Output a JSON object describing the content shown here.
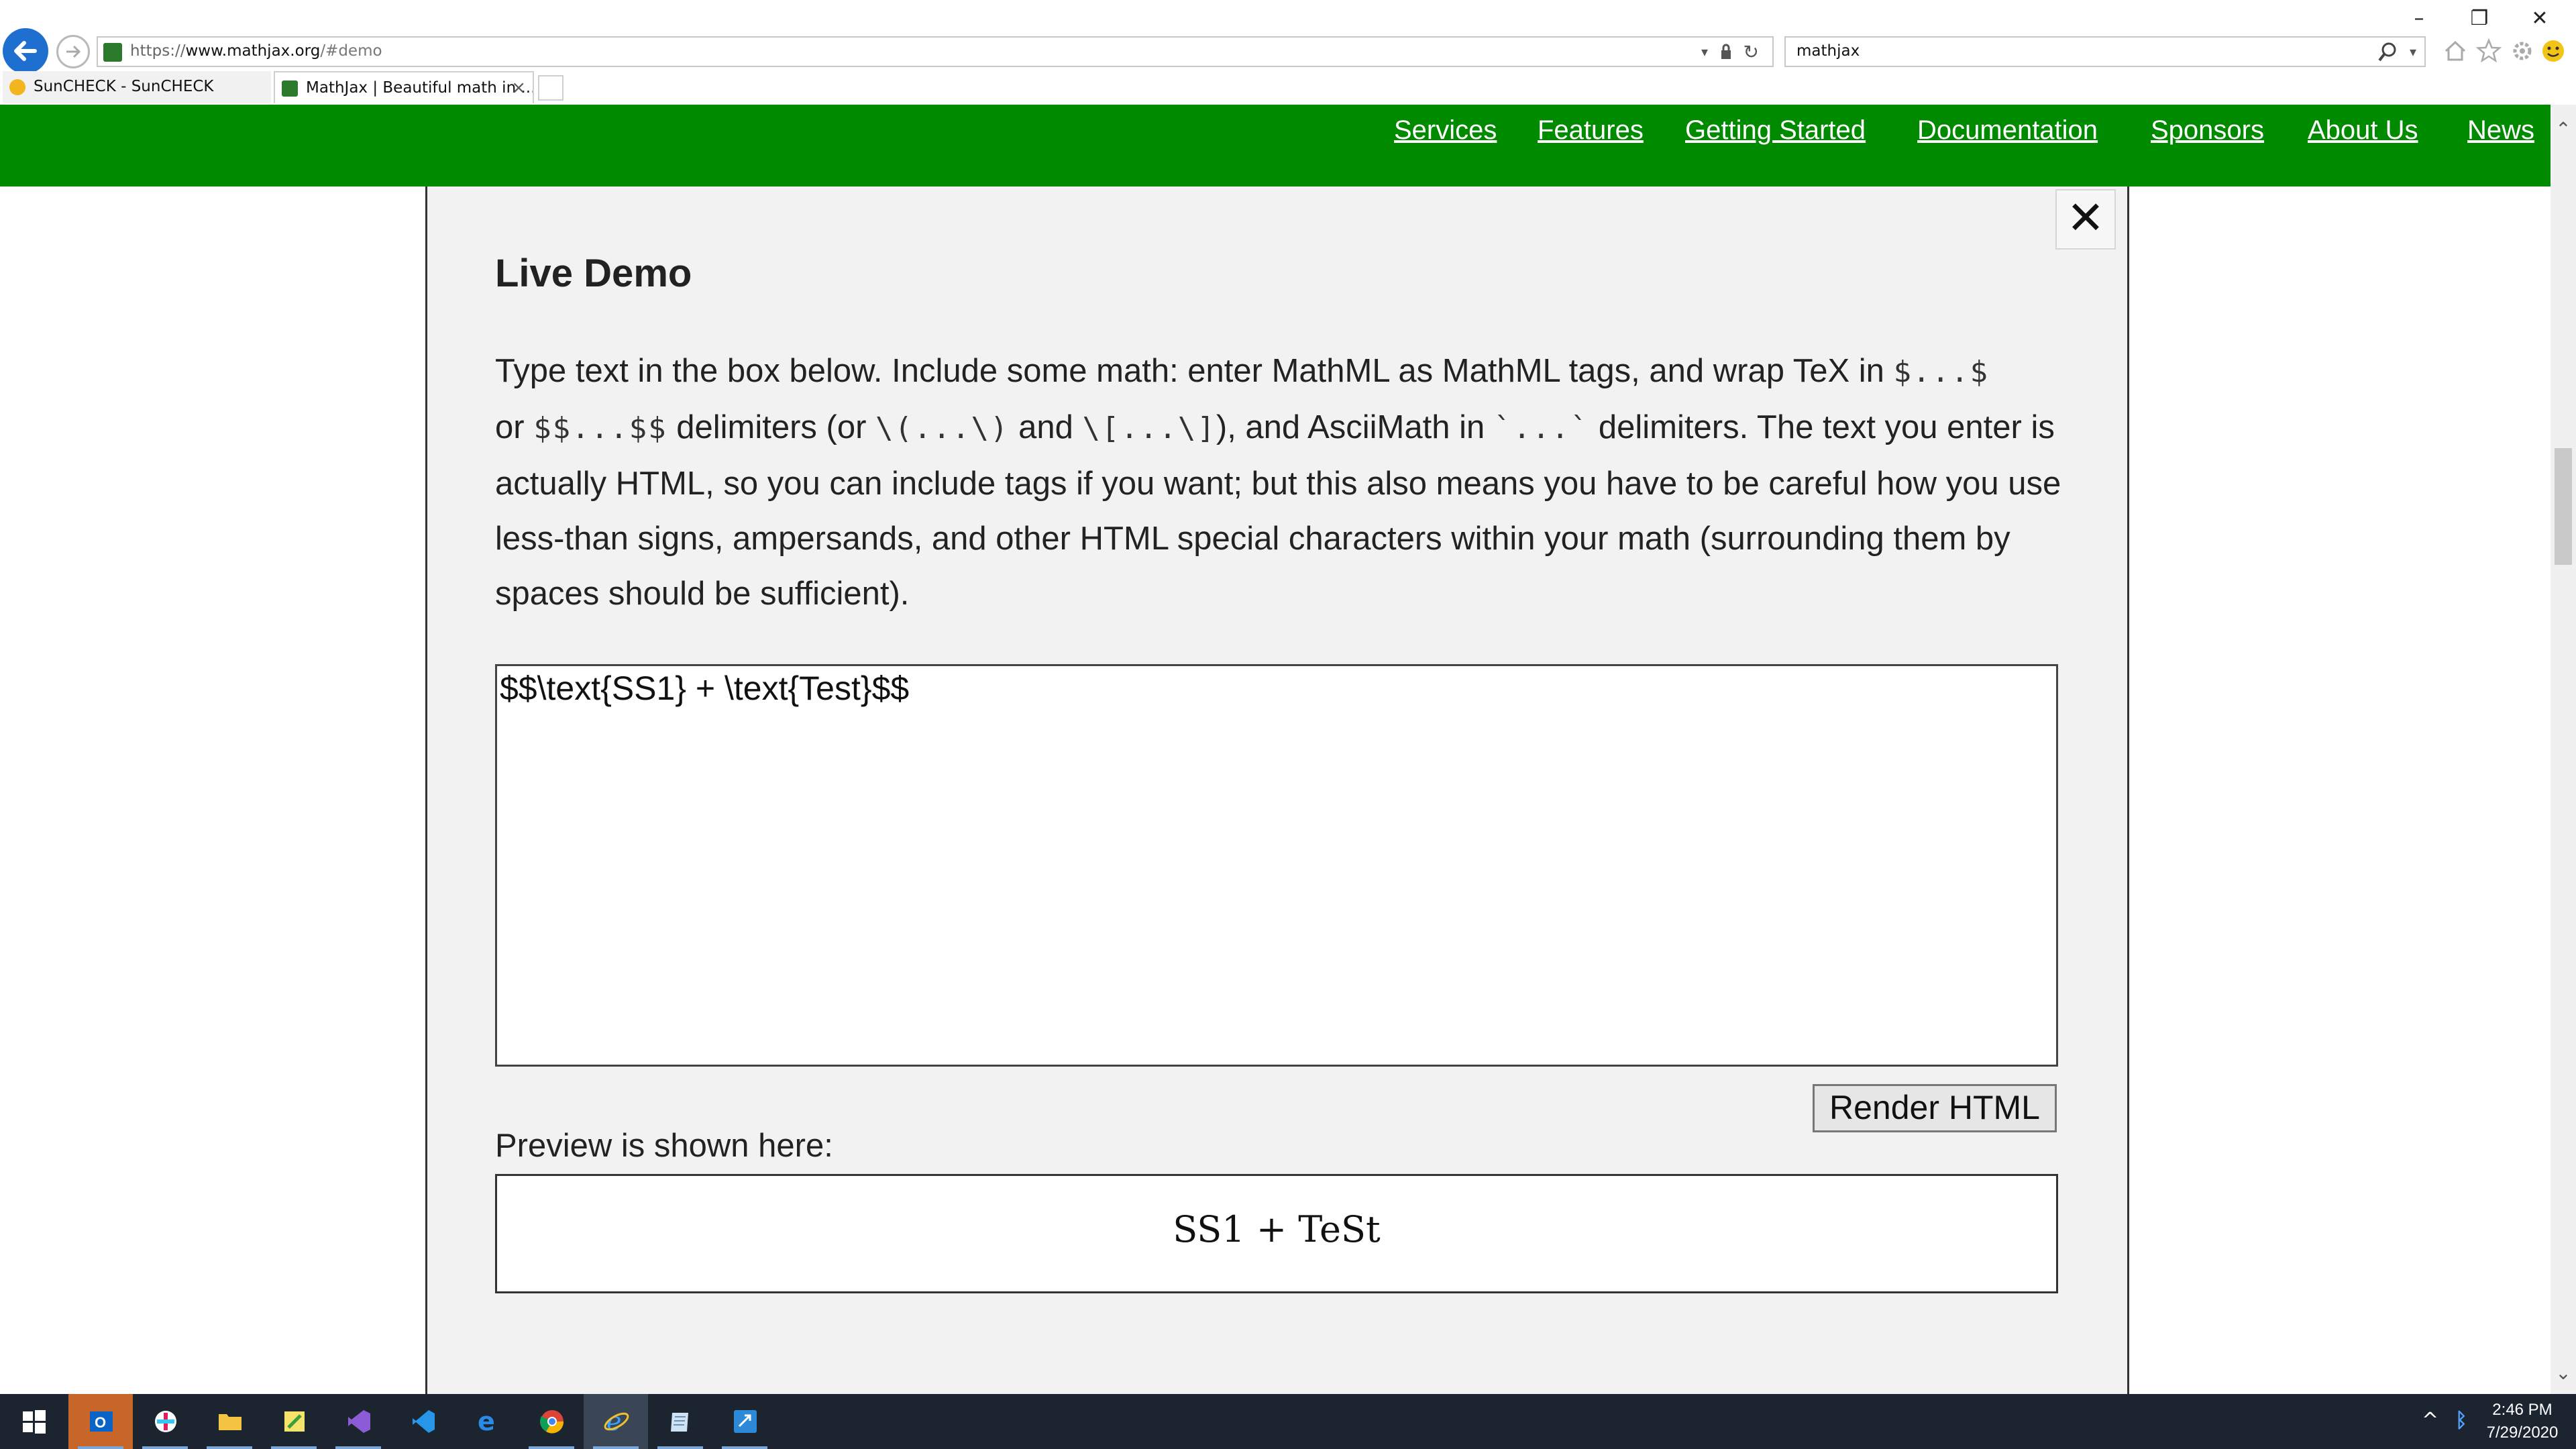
{
  "browser": {
    "address": {
      "protocol": "https://",
      "host": "www.mathjax.org",
      "path": "/#demo"
    },
    "search_query": "mathjax",
    "tabs": [
      {
        "label": "SunCHECK - SunCHECK",
        "favicon_color": "#f2b51e"
      },
      {
        "label": "MathJax | Beautiful math in ...",
        "favicon_color": "#2c7a2c",
        "close": "×"
      }
    ],
    "window_controls": {
      "minimize": "–",
      "restore": "❐",
      "close": "✕"
    }
  },
  "site_nav": {
    "background": "#008a00",
    "links": [
      "Services",
      "Features",
      "Getting Started",
      "Documentation",
      "Sponsors",
      "About Us",
      "News"
    ]
  },
  "demo": {
    "close_symbol": "✕",
    "title": "Live Demo",
    "intro": {
      "p1": "Type text in the box below. Include some math: enter MathML as MathML tags, and wrap TeX in ",
      "code1": "$...$",
      "p2": "or ",
      "code2": "$$...$$",
      "p3": " delimiters (or ",
      "code3": "\\(...\\)",
      "p4": " and ",
      "code4": "\\[...\\]",
      "p5": "), and AsciiMath in ",
      "code5": "`...`",
      "p6": " delimiters. The text you enter is actually HTML, so you can include tags if you want; but this also means you have to be careful how you use less-than signs, ampersands, and other HTML special characters within your math (surrounding them by spaces should be sufficient)."
    },
    "textarea_value": "$$\\text{SS1} + \\text{Test}$$",
    "render_button": "Render HTML",
    "preview_label": "Preview is shown here:",
    "preview_math": "SS1 + TeSt"
  },
  "taskbar": {
    "time": "2:46 PM",
    "date": "7/29/2020",
    "tray_chevron": "^",
    "bluetooth_symbol": "ᛒ",
    "icons": [
      "windows-start",
      "outlook",
      "slack",
      "file-explorer",
      "sticky-notes",
      "visual-studio",
      "vs-code",
      "edge",
      "chrome",
      "internet-explorer",
      "notepad",
      "remote-desktop"
    ]
  }
}
